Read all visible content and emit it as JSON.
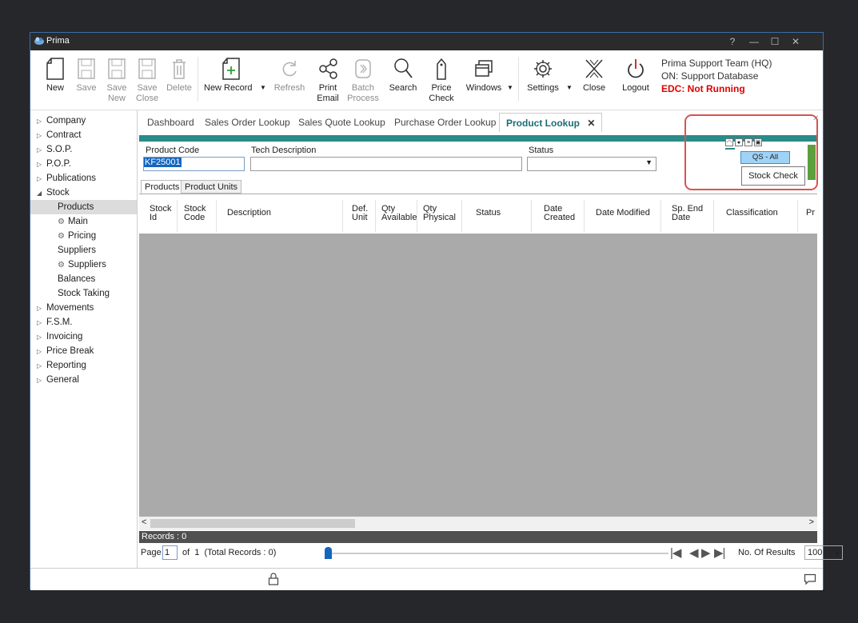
{
  "window": {
    "title": "Prima"
  },
  "titlebar": {
    "help": "?",
    "minimize": "—",
    "maximize": "☐",
    "close": "✕"
  },
  "ribbon": {
    "new": "New",
    "save": "Save",
    "save_new": [
      "Save",
      "New"
    ],
    "save_close": [
      "Save",
      "Close"
    ],
    "delete": "Delete",
    "new_record": "New Record",
    "refresh": "Refresh",
    "print_email": [
      "Print",
      "Email"
    ],
    "batch_process": [
      "Batch",
      "Process"
    ],
    "search": "Search",
    "price_check": [
      "Price",
      "Check"
    ],
    "windows": "Windows",
    "settings": "Settings",
    "close": "Close",
    "logout": "Logout"
  },
  "support": {
    "line1": "Prima Support Team (HQ)",
    "line2": "ON: Support Database",
    "line3": "EDC: Not Running"
  },
  "nav": [
    {
      "label": "Company",
      "arrow": "▷"
    },
    {
      "label": "Contract",
      "arrow": "▷"
    },
    {
      "label": "S.O.P.",
      "arrow": "▷"
    },
    {
      "label": "P.O.P.",
      "arrow": "▷"
    },
    {
      "label": "Publications",
      "arrow": "▷"
    },
    {
      "label": "Stock",
      "arrow": "◢"
    },
    {
      "label": "Products"
    },
    {
      "label": "Main",
      "gear": "⚙"
    },
    {
      "label": "Pricing",
      "gear": "⚙"
    },
    {
      "label": "Suppliers"
    },
    {
      "label": "Suppliers",
      "gear": "⚙"
    },
    {
      "label": "Balances"
    },
    {
      "label": "Stock Taking"
    },
    {
      "label": "Movements",
      "arrow": "▷"
    },
    {
      "label": "F.S.M.",
      "arrow": "▷"
    },
    {
      "label": "Invoicing",
      "arrow": "▷"
    },
    {
      "label": "Price Break",
      "arrow": "▷"
    },
    {
      "label": "Reporting",
      "arrow": "▷"
    },
    {
      "label": "General",
      "arrow": "▷"
    }
  ],
  "tabs": [
    "Dashboard",
    "Sales Order Lookup",
    "Sales Quote Lookup",
    "Purchase Order Lookup",
    "Product Lookup"
  ],
  "tab_close": "✕",
  "filter": {
    "product_code_label": "Product Code",
    "product_code_value": "KF25001",
    "tech_desc_label": "Tech Description",
    "status_label": "Status",
    "qs_all": "QS - All",
    "stock_check": "Stock Check"
  },
  "subtabs": [
    "Products",
    "Product Units"
  ],
  "columns": [
    [
      "Stock",
      "Id"
    ],
    [
      "Stock",
      "Code"
    ],
    [
      "Description"
    ],
    [
      "Def.",
      "Unit"
    ],
    [
      "Qty",
      "Available"
    ],
    [
      "Qty",
      "Physical"
    ],
    [
      "Status"
    ],
    [
      "Date",
      "Created"
    ],
    [
      "Date Modified"
    ],
    [
      "Sp. End",
      "Date"
    ],
    [
      "Classification"
    ],
    [
      "Pr"
    ]
  ],
  "records": "Records : 0",
  "pager": {
    "page_label": "Page",
    "page_value": "1",
    "of_text": "of  1  (Total Records : 0)",
    "results_label": "No. Of Results",
    "results_value": "100"
  }
}
